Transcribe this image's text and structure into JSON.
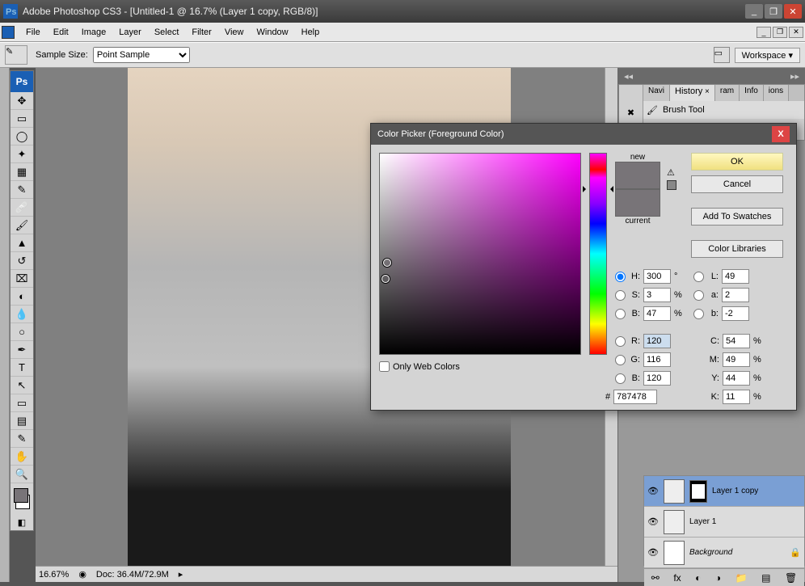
{
  "title": "Adobe Photoshop CS3 - [Untitled-1 @ 16.7% (Layer 1 copy, RGB/8)]",
  "menu": [
    "File",
    "Edit",
    "Image",
    "Layer",
    "Select",
    "Filter",
    "View",
    "Window",
    "Help"
  ],
  "options": {
    "sample_label": "Sample Size:",
    "sample_value": "Point Sample",
    "workspace": "Workspace ▾"
  },
  "status": {
    "zoom": "16.67%",
    "doc": "Doc: 36.4M/72.9M"
  },
  "panels": {
    "tabs": [
      "Navi",
      "History",
      "ram",
      "Info",
      "ions"
    ],
    "active_tab": 1,
    "history_item": "Brush Tool"
  },
  "layers": [
    {
      "name": "Layer 1 copy",
      "selected": true,
      "mask": true
    },
    {
      "name": "Layer 1",
      "selected": false,
      "mask": false
    },
    {
      "name": "Background",
      "selected": false,
      "mask": false,
      "locked": true,
      "italic": true
    }
  ],
  "tools": [
    "↕",
    "▭",
    "◫",
    "✂",
    "▦",
    "✎",
    "🩹",
    "🖌",
    "⌧",
    "◔",
    "⬚",
    "▲",
    "T",
    "⬊",
    "▭",
    "✋",
    "🔍"
  ],
  "colorpicker": {
    "title": "Color Picker (Foreground Color)",
    "btn_ok": "OK",
    "btn_cancel": "Cancel",
    "btn_swatches": "Add To Swatches",
    "btn_libraries": "Color Libraries",
    "new_label": "new",
    "current_label": "current",
    "webonly": "Only Web Colors",
    "new_color": "#787478",
    "current_color": "#787478",
    "fields": {
      "H": "300",
      "S": "3",
      "B": "47",
      "L": "49",
      "a": "2",
      "b": "-2",
      "R": "120",
      "G": "116",
      "Bv": "120",
      "C": "54",
      "M": "49",
      "Y": "44",
      "K": "11",
      "hex": "787478"
    }
  }
}
